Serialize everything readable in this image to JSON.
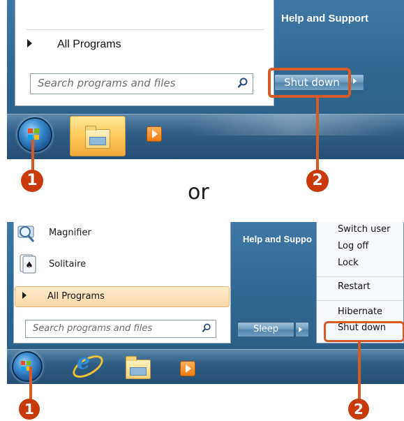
{
  "panel_top": {
    "help_and_support": "Help and Support",
    "all_programs": "All Programs",
    "search_placeholder": "Search programs and files",
    "shut_down_label": "Shut down"
  },
  "separator_word": "or",
  "panel_bottom": {
    "programs": [
      {
        "label": "Magnifier",
        "icon": "magnifier-icon"
      },
      {
        "label": "Solitaire",
        "icon": "solitaire-icon"
      }
    ],
    "all_programs": "All Programs",
    "search_placeholder": "Search programs and files",
    "help_and_support": "Help and Suppo",
    "sleep_label": "Sleep",
    "power_menu": {
      "switch_user": "Switch user",
      "log_off": "Log off",
      "lock": "Lock",
      "restart": "Restart",
      "hibernate": "Hibernate",
      "shut_down": "Shut down"
    }
  },
  "callouts": {
    "one": "1",
    "two": "2"
  },
  "colors": {
    "callout": "#d45a26",
    "callout_badge": "#c83a0a",
    "desktop_blue": "#2f6892"
  }
}
